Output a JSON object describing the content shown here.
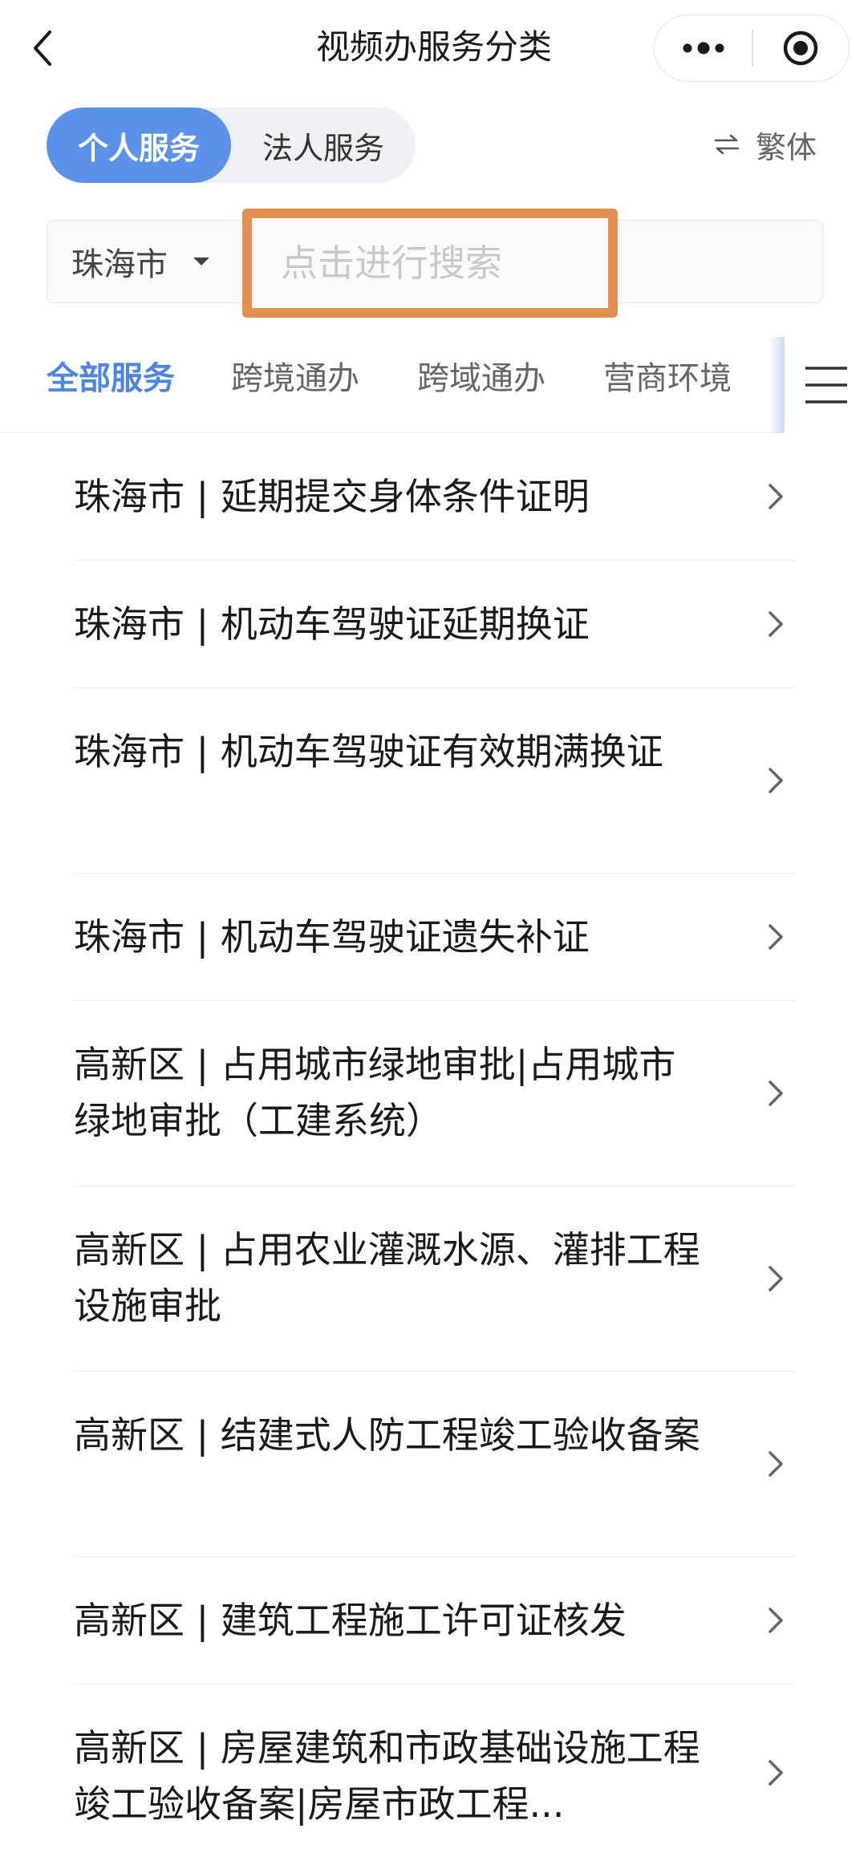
{
  "nav": {
    "title": "视频办服务分类"
  },
  "service_toggle": {
    "active": "个人服务",
    "inactive": "法人服务"
  },
  "language_toggle": {
    "label": "繁体"
  },
  "search": {
    "city": "珠海市",
    "placeholder": "点击进行搜索"
  },
  "tabs": [
    "全部服务",
    "跨境通办",
    "跨域通办",
    "营商环境"
  ],
  "items": [
    "珠海市 | 延期提交身体条件证明",
    "珠海市 | 机动车驾驶证延期换证",
    "珠海市 | 机动车驾驶证有效期满换证",
    "珠海市 | 机动车驾驶证遗失补证",
    "高新区 | 占用城市绿地审批|占用城市绿地审批（工建系统）",
    "高新区 | 占用农业灌溉水源、灌排工程设施审批",
    "高新区 | 结建式人防工程竣工验收备案",
    "高新区 | 建筑工程施工许可证核发",
    "高新区 | 房屋建筑和市政基础设施工程竣工验收备案|房屋市政工程..."
  ],
  "colors": {
    "accent": "#4a86e8",
    "segment_active": "#5b92e9",
    "highlight_border": "#e38f4f"
  },
  "icons": {
    "back": "back-chevron-icon",
    "more": "more-dots-icon",
    "close": "close-circle-icon",
    "swap": "swap-arrows-icon",
    "dropdown": "caret-down-icon",
    "menu": "hamburger-menu-icon",
    "chevron": "chevron-right-icon"
  }
}
